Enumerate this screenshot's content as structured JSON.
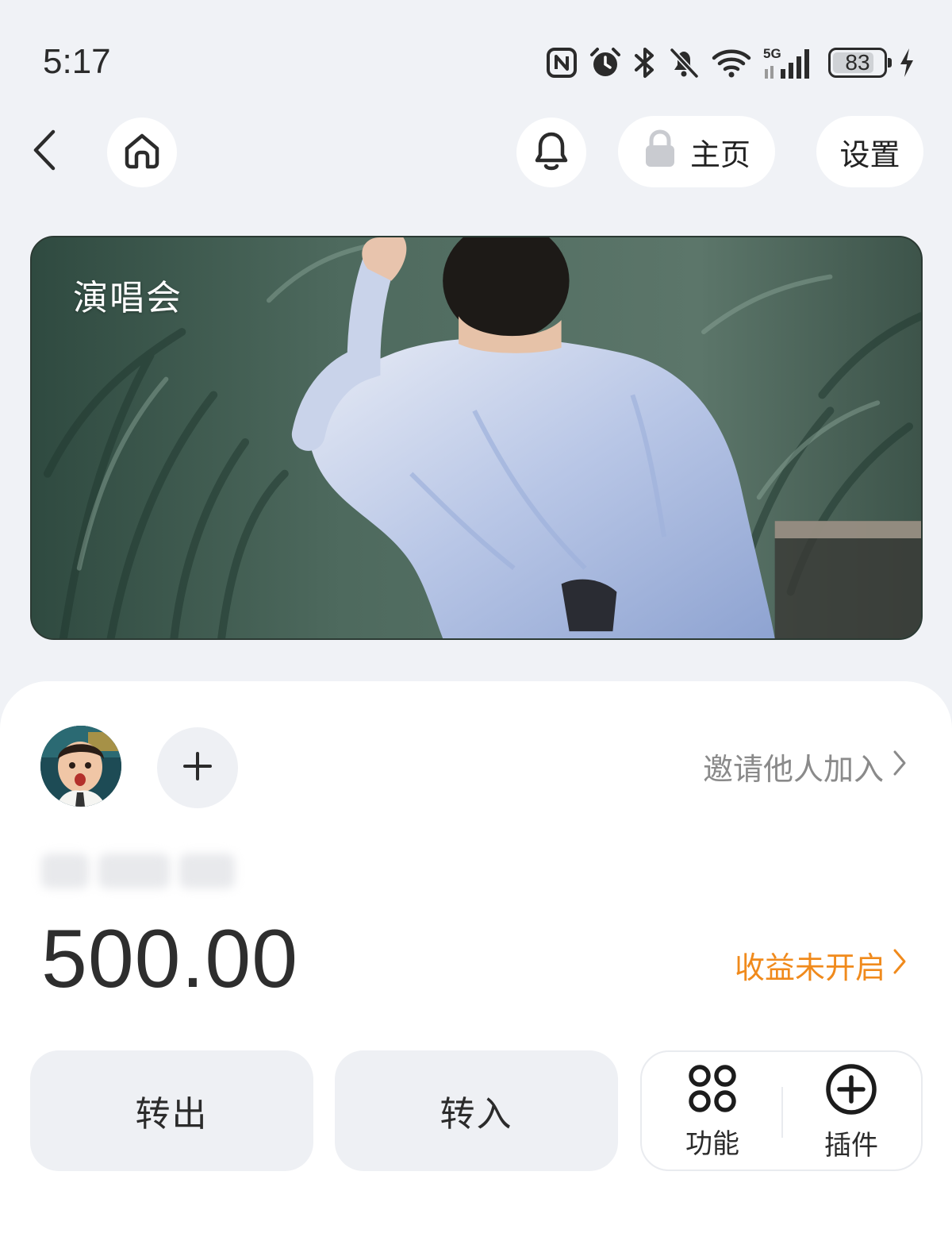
{
  "status_bar": {
    "time": "5:17",
    "battery": "83",
    "battery_level": 0.83,
    "network": "5G",
    "icons": [
      "nfc-icon",
      "alarm-icon",
      "bluetooth-icon",
      "mute-icon",
      "wifi-icon",
      "signal-icon",
      "battery-icon",
      "charging-icon"
    ]
  },
  "nav": {
    "back_icon": "back-arrow-icon",
    "home_icon": "home-icon",
    "bell_icon": "bell-icon",
    "homepage_label": "主页",
    "homepage_icon": "lock-icon",
    "settings_label": "设置"
  },
  "banner": {
    "title": "演唱会"
  },
  "card": {
    "avatar_icon": "avatar",
    "add_icon": "plus-icon",
    "invite_label": "邀请他人加入",
    "balance": "500.00",
    "earnings_label": "收益未开启",
    "actions": {
      "transfer_out": "转出",
      "transfer_in": "转入"
    },
    "tools": {
      "features_label": "功能",
      "features_icon": "four-circles-icon",
      "plugins_label": "插件",
      "plugins_icon": "plus-circle-icon"
    }
  },
  "colors": {
    "background": "#f0f2f6",
    "card": "#ffffff",
    "accent_orange": "#f08a1c",
    "muted_text": "#8a8a8a",
    "button_bg": "#eef0f4"
  }
}
